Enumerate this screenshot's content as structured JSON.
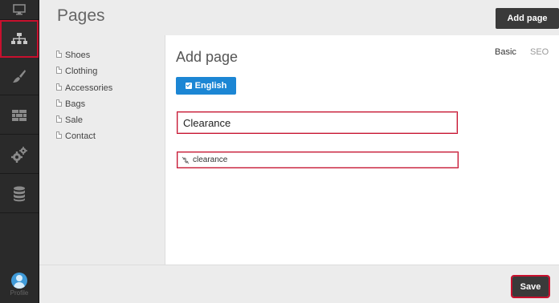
{
  "header": {
    "title": "Pages",
    "add_page_label": "Add page"
  },
  "sidebar": {
    "items": [
      {
        "icon": "monitor-icon"
      },
      {
        "icon": "sitemap-icon",
        "active": true
      },
      {
        "icon": "brush-icon"
      },
      {
        "icon": "bricks-icon"
      },
      {
        "icon": "gears-icon"
      },
      {
        "icon": "database-icon"
      }
    ],
    "profile_label": "Profile"
  },
  "tree": {
    "items": [
      "Shoes",
      "Clothing",
      "Accessories",
      "Bags",
      "Sale",
      "Contact"
    ]
  },
  "main": {
    "title": "Add page",
    "tabs": [
      {
        "label": "Basic",
        "active": true
      },
      {
        "label": "SEO",
        "active": false
      }
    ],
    "language_label": "English",
    "title_input_value": "Clearance",
    "slug_value": "clearance"
  },
  "footer": {
    "save_label": "Save"
  },
  "colors": {
    "accent": "#1c86d4",
    "error": "#c8102e",
    "sidebar": "#2a2a2a"
  }
}
